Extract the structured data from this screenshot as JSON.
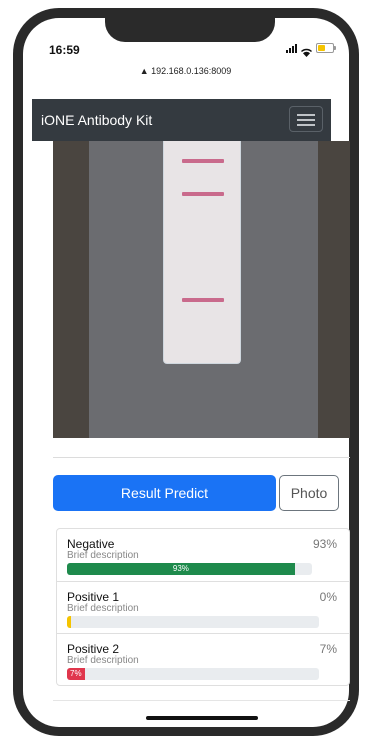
{
  "status_bar": {
    "time": "16:59"
  },
  "browser": {
    "url": "▲ 192.168.0.136:8009"
  },
  "navbar": {
    "brand": "iONE Antibody Kit"
  },
  "actions": {
    "predict_label": "Result Predict",
    "photo_label": "Photo"
  },
  "results": [
    {
      "name": "Negative",
      "description": "Brief description",
      "percent_text": "93%",
      "bar_label": "93%",
      "progress": 0.93,
      "color": "#1e8a4c"
    },
    {
      "name": "Positive 1",
      "description": "Brief description",
      "percent_text": "0%",
      "bar_label": "",
      "progress": 0.0,
      "color": "#f5c400"
    },
    {
      "name": "Positive 2",
      "description": "Brief description",
      "percent_text": "7%",
      "bar_label": "7%",
      "progress": 0.07,
      "color": "#e0364c"
    }
  ],
  "colors": {
    "navbar_bg": "#343a40",
    "primary": "#1a73f5"
  }
}
